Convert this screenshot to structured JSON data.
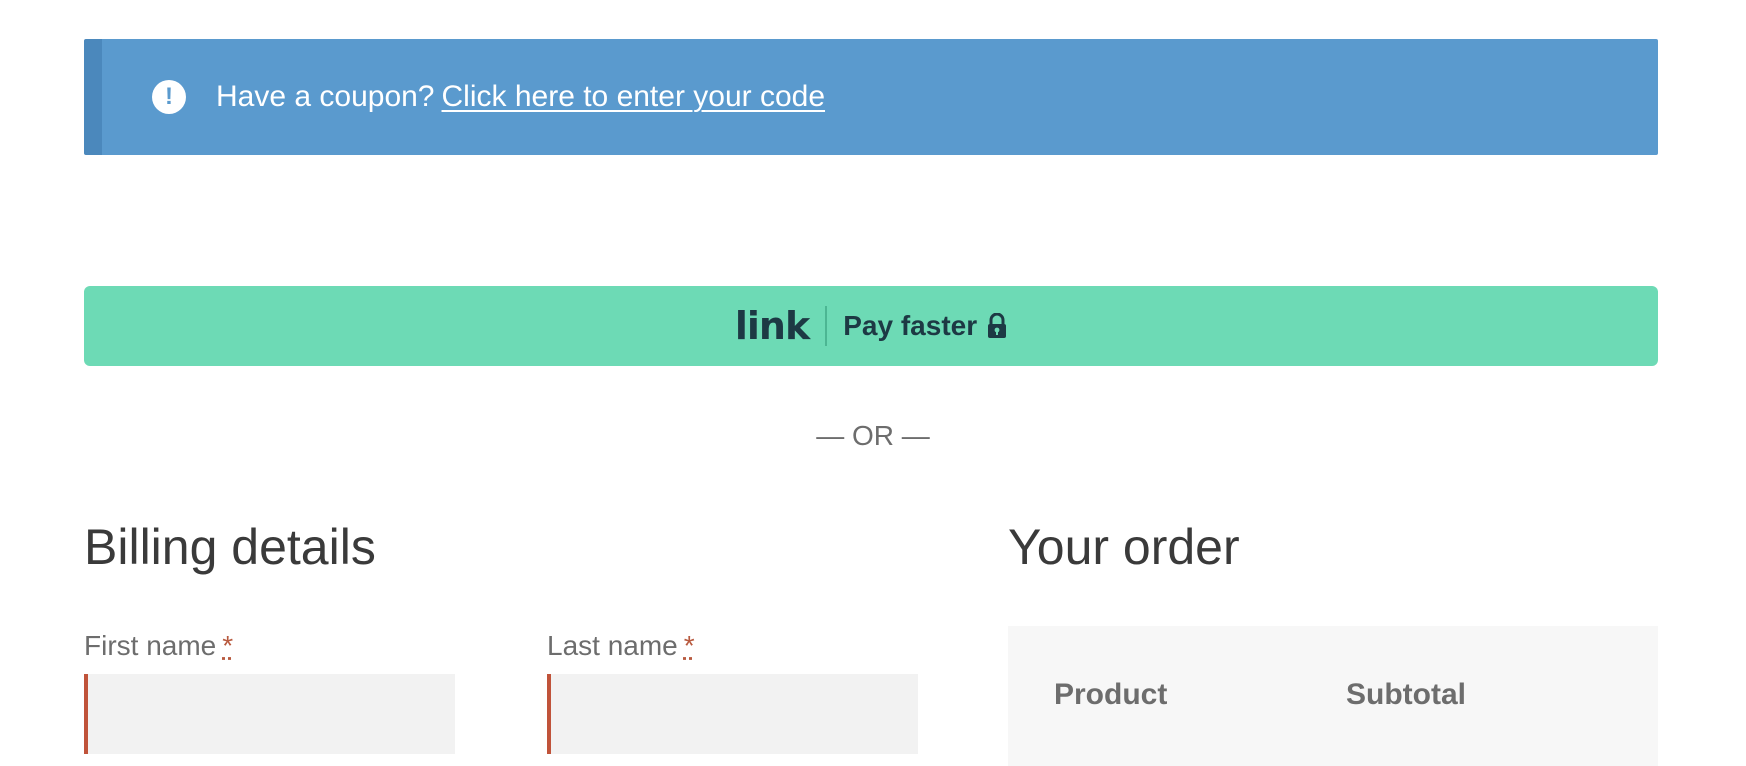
{
  "coupon_notice": {
    "text": "Have a coupon?",
    "link_text": "Click here to enter your code",
    "icon": "info-icon"
  },
  "link_button": {
    "logo": "link",
    "label": "Pay faster",
    "icon": "lock-icon"
  },
  "or_divider": "— OR —",
  "billing": {
    "title": "Billing details",
    "first_name_label": "First name",
    "last_name_label": "Last name",
    "required_marker": "*",
    "first_name_value": "",
    "last_name_value": ""
  },
  "order": {
    "title": "Your order",
    "columns": [
      "Product",
      "Subtotal"
    ]
  },
  "colors": {
    "notice_bg": "#5a9ace",
    "link_button_bg": "#6ddab5",
    "required_accent": "#c0533a"
  }
}
